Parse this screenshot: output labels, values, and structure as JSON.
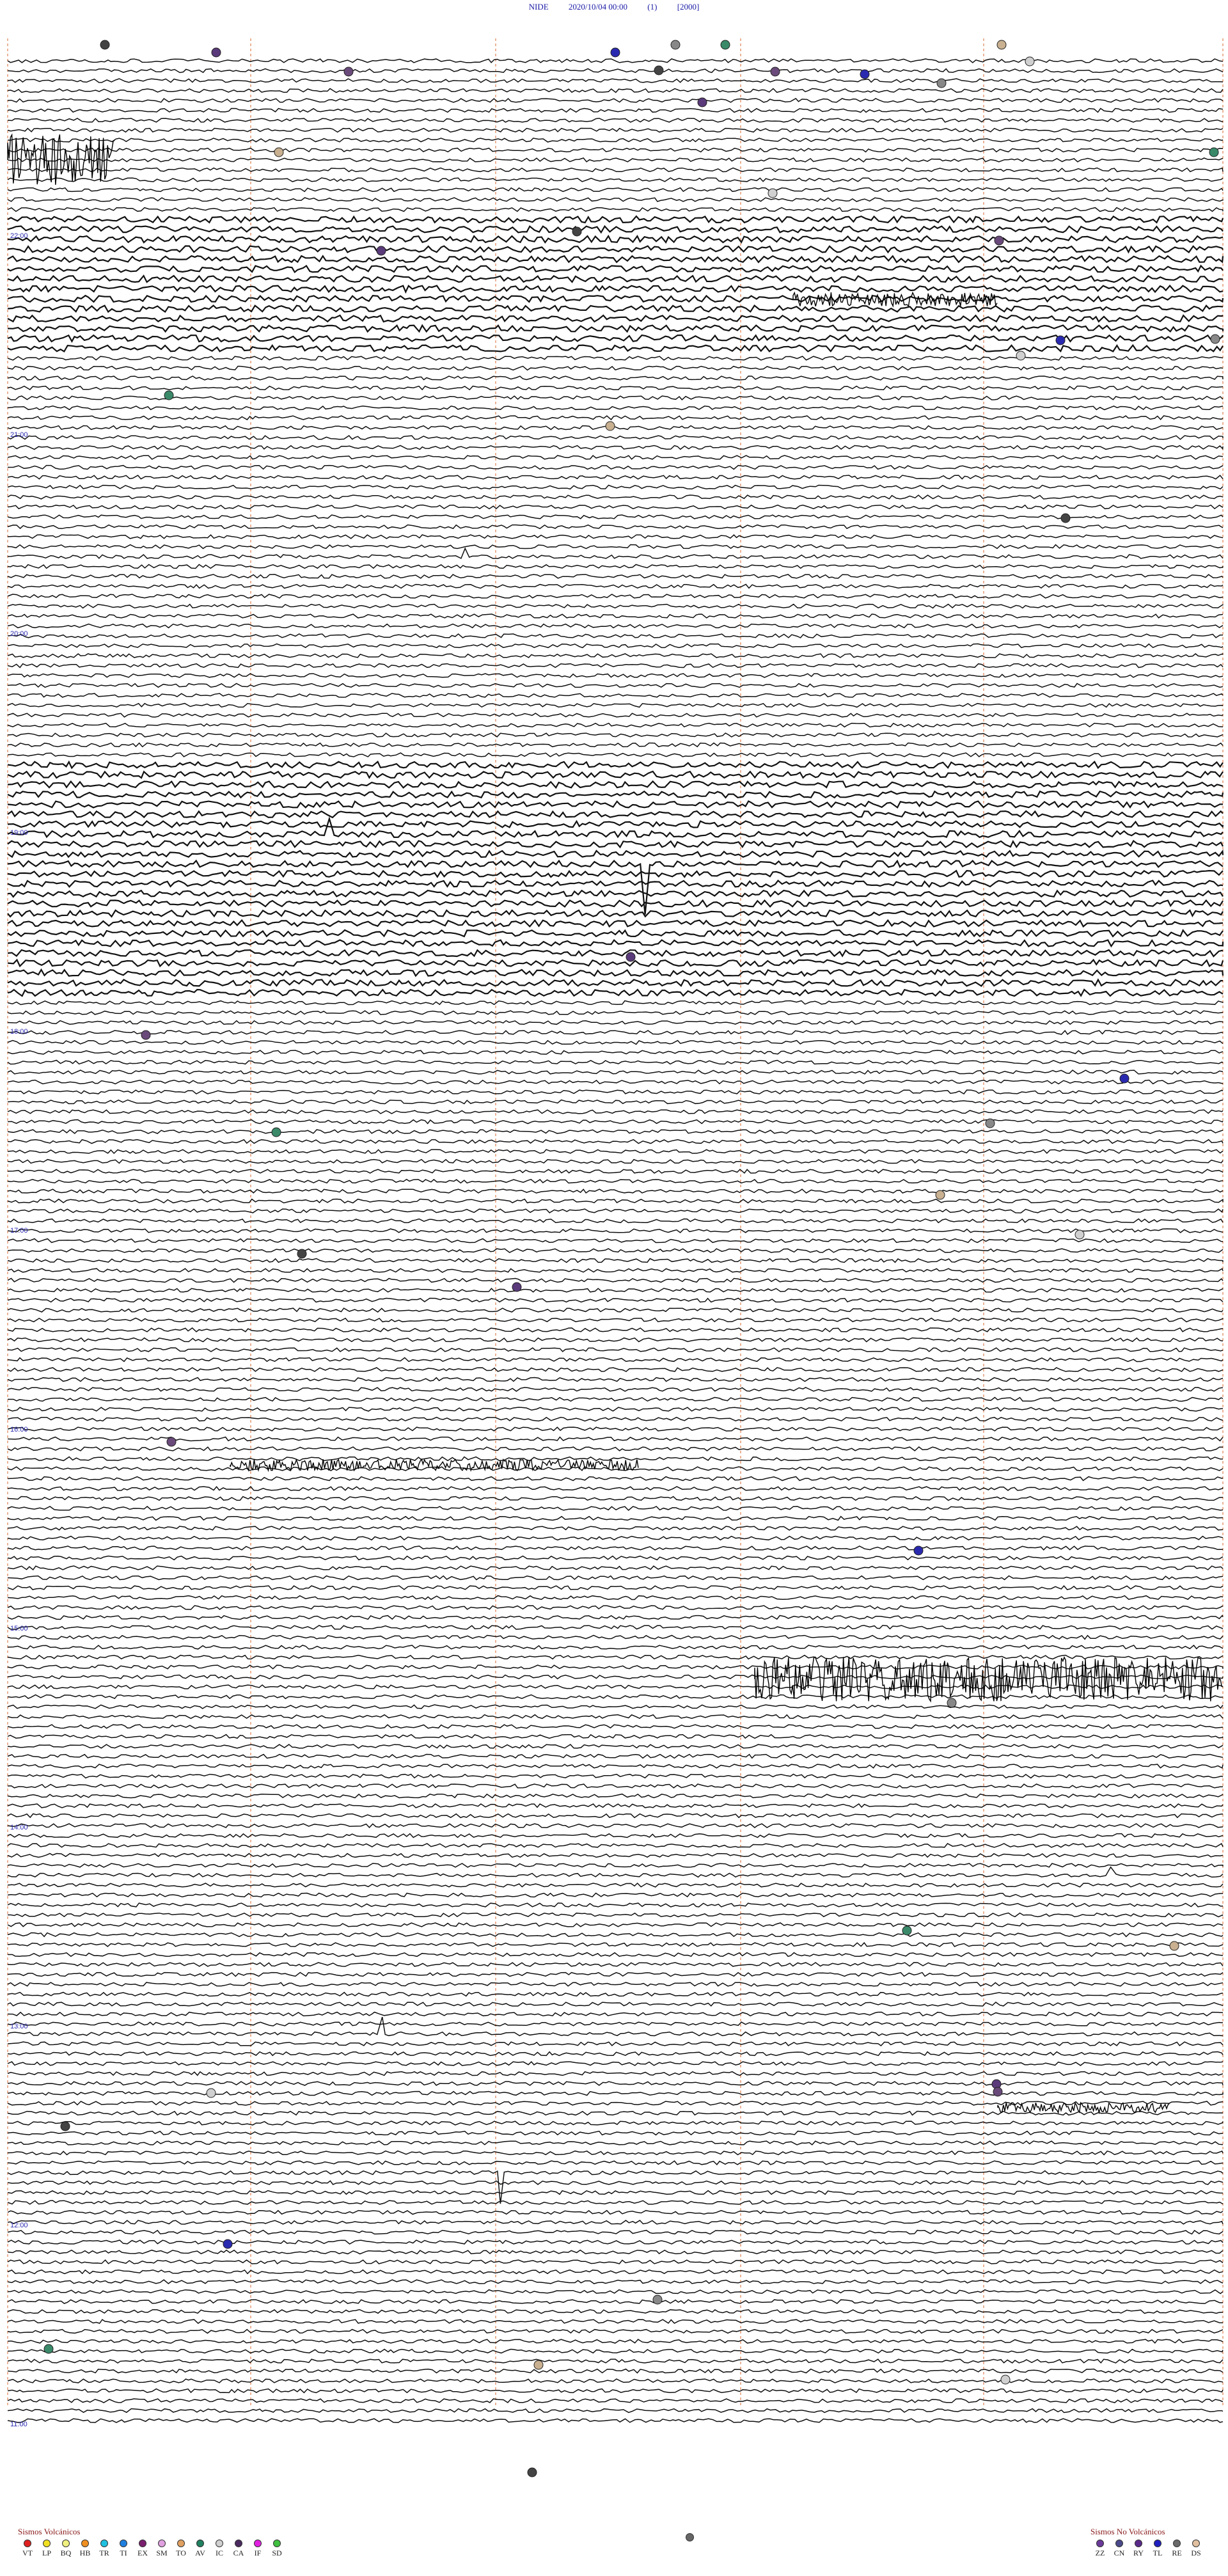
{
  "header": {
    "station": "NIDE",
    "datetime": "2020/10/04 00:00",
    "component": "(1)",
    "scale": "[2000]"
  },
  "time_labels": [
    "22:00",
    "21:00",
    "20:00",
    "19:00",
    "18:00",
    "17:00",
    "16:00",
    "15:00",
    "14:00",
    "13:00",
    "12:00",
    "11:00",
    "10:00"
  ],
  "legend_volcanic": {
    "title": "Sismos Volcánicos",
    "items": [
      {
        "code": "VT",
        "color": "#e02020"
      },
      {
        "code": "LP",
        "color": "#f0e020"
      },
      {
        "code": "BQ",
        "color": "#f0f080"
      },
      {
        "code": "HB",
        "color": "#f09020"
      },
      {
        "code": "TR",
        "color": "#20c0e0"
      },
      {
        "code": "TI",
        "color": "#2080e0"
      },
      {
        "code": "EX",
        "color": "#7a1f6e"
      },
      {
        "code": "SM",
        "color": "#e0a0e0"
      },
      {
        "code": "TO",
        "color": "#e0a060"
      },
      {
        "code": "AV",
        "color": "#208060"
      },
      {
        "code": "IC",
        "color": "#d0d0d0"
      },
      {
        "code": "CA",
        "color": "#4a2a60"
      },
      {
        "code": "IF",
        "color": "#e020e0"
      },
      {
        "code": "SD",
        "color": "#40c040"
      }
    ]
  },
  "legend_nonvolcanic": {
    "title": "Sismos No Volcánicos",
    "items": [
      {
        "code": "ZZ",
        "color": "#6a3a9a"
      },
      {
        "code": "CN",
        "color": "#4a4a8a"
      },
      {
        "code": "RY",
        "color": "#5a2a8a"
      },
      {
        "code": "TL",
        "color": "#2020c0"
      },
      {
        "code": "RE",
        "color": "#6a6a6a"
      },
      {
        "code": "DS",
        "color": "#e0c0a0"
      }
    ]
  }
}
